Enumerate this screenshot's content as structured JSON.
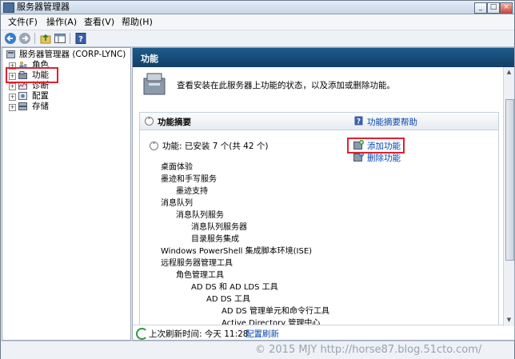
{
  "window": {
    "title": "服务器管理器",
    "app_icon": "server-manager-icon"
  },
  "menu": [
    "文件(F)",
    "操作(A)",
    "查看(V)",
    "帮助(H)"
  ],
  "tree": {
    "root": "服务器管理器 (CORP-LYNC)",
    "items": [
      "角色",
      "功能",
      "诊断",
      "配置",
      "存储"
    ]
  },
  "banner": {
    "title": "功能"
  },
  "description": "查看安装在此服务器上功能的状态，以及添加或删除功能。",
  "summary": {
    "title": "功能摘要",
    "help_link": "功能摘要帮助",
    "installed": "功能: 已安装 7 个(共 42 个)",
    "actions": {
      "add": "添加功能",
      "remove": "删除功能"
    },
    "features": [
      {
        "label": "桌面体验",
        "level": 0
      },
      {
        "label": "墨迹和手写服务",
        "level": 0
      },
      {
        "label": "墨迹支持",
        "level": 1
      },
      {
        "label": "消息队列",
        "level": 0
      },
      {
        "label": "消息队列服务",
        "level": 1
      },
      {
        "label": "消息队列服务器",
        "level": 2
      },
      {
        "label": "目录服务集成",
        "level": 2
      },
      {
        "label": "Windows PowerShell 集成脚本环境(ISE)",
        "level": 0
      },
      {
        "label": "远程服务器管理工具",
        "level": 0
      },
      {
        "label": "角色管理工具",
        "level": 1
      },
      {
        "label": "AD DS 和 AD LDS 工具",
        "level": 2
      },
      {
        "label": "AD DS 工具",
        "level": 3
      },
      {
        "label": "AD DS 管理单元和命令行工具",
        "level": 4
      },
      {
        "label": "Active Directory 管理中心",
        "level": 4
      }
    ]
  },
  "refresh": {
    "text": "上次刷新时间: 今天 11:28",
    "link": "配置刷新"
  },
  "watermark": "© 2015 MJY http://horse87.blog.51cto.com/",
  "colors": {
    "banner": "#1d5b8c",
    "highlight": "#e0212c",
    "link": "#0645ad"
  }
}
